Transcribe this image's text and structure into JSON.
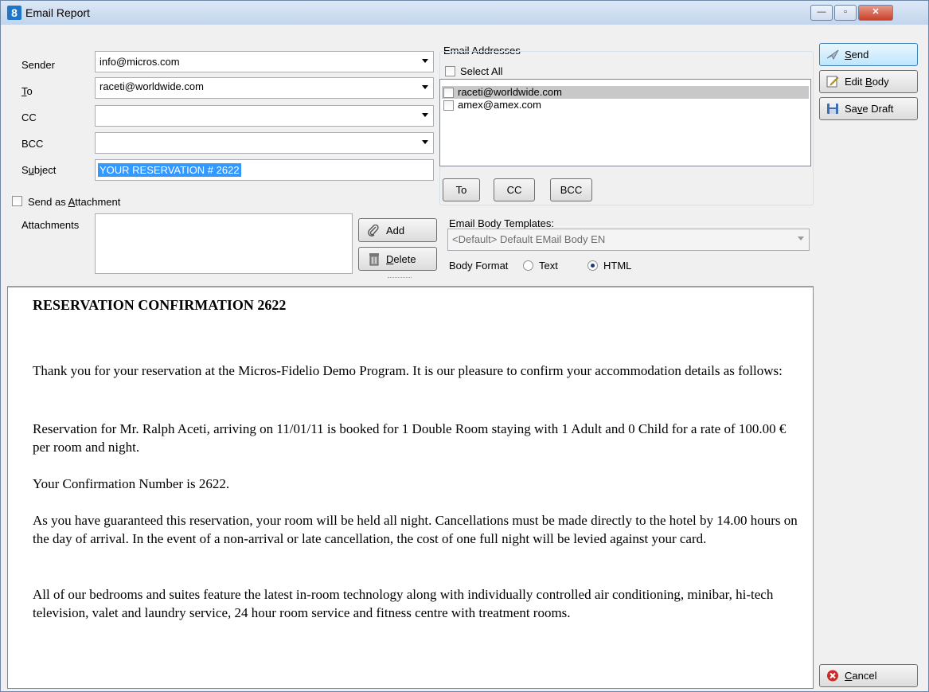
{
  "window": {
    "title": "Email Report",
    "app_icon": "8",
    "controls": {
      "minimize": "—",
      "maximize": "▫",
      "close": "✕"
    }
  },
  "sender": {
    "label_pre": "Sender",
    "value": "info@micros.com"
  },
  "to": {
    "label_u": "T",
    "label_rest": "o",
    "value": "raceti@worldwide.com"
  },
  "cc": {
    "label": "CC",
    "value": ""
  },
  "bcc": {
    "label": "BCC",
    "value": ""
  },
  "subject": {
    "label_pre": "S",
    "label_u": "u",
    "label_rest": "bject",
    "value": "YOUR RESERVATION # 2622"
  },
  "attachment": {
    "send_pre": "Send as ",
    "send_u": "A",
    "send_rest": "ttachment",
    "label": "Attachments",
    "add": "Add",
    "delete_u": "D",
    "delete_rest": "elete"
  },
  "addresses": {
    "group_label": "Email Addresses",
    "select_all": "Select All",
    "items": [
      "raceti@worldwide.com",
      "amex@amex.com"
    ],
    "to_btn": "To",
    "cc_btn": "CC",
    "bcc_btn": "BCC"
  },
  "templates": {
    "label": "Email Body Templates:",
    "value": "<Default> Default EMail Body EN",
    "format_label": "Body Format",
    "format_text": "Text",
    "format_html": "HTML"
  },
  "body": {
    "heading": "RESERVATION CONFIRMATION 2622",
    "p1": "Thank you for your reservation at the Micros-Fidelio Demo Program.  It is our pleasure to confirm your accommodation details as follows:",
    "p2": "Reservation for Mr. Ralph Aceti, arriving on 11/01/11 is booked for  1 Double Room staying with 1 Adult and 0 Child for a rate of 100.00 € per room and night.",
    "p3": "Your Confirmation Number is 2622.",
    "p4": "As you have guaranteed this reservation, your room will be held all night. Cancellations must be made directly to the hotel by 14.00 hours on the day of arrival. In the event of a non-arrival or late cancellation, the cost of one full night will be levied against your card.",
    "p5": "All of our bedrooms and suites feature the latest in-room technology along with individually controlled air conditioning, minibar, hi-tech television, valet and laundry service, 24 hour room service and fitness centre with treatment rooms."
  },
  "actions": {
    "send_u": "S",
    "send_rest": "end",
    "edit_pre": "Edit ",
    "edit_u": "B",
    "edit_rest": "ody",
    "save_pre": "Sa",
    "save_u": "v",
    "save_rest": "e Draft",
    "cancel_u": "C",
    "cancel_rest": "ancel"
  }
}
